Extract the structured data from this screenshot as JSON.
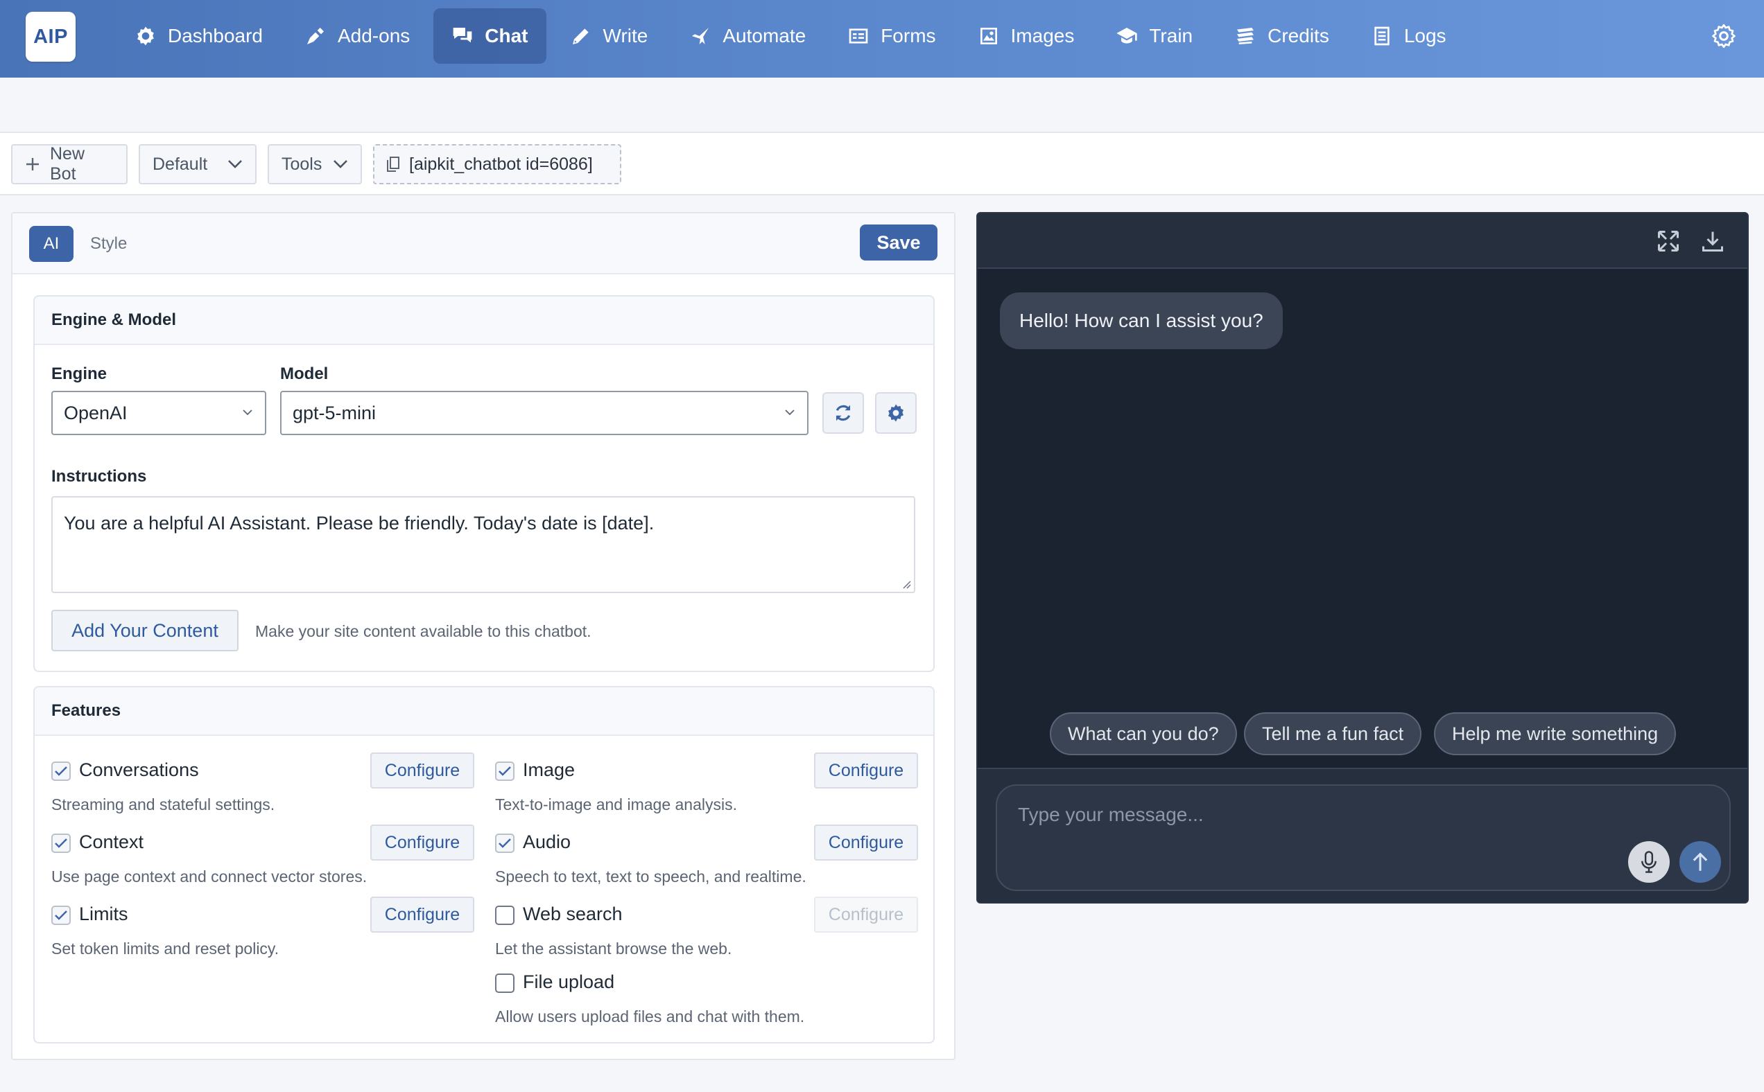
{
  "app": {
    "logo_text": "AIP"
  },
  "nav": {
    "items": [
      {
        "label": "Dashboard",
        "icon": "dashboard-icon"
      },
      {
        "label": "Add-ons",
        "icon": "addons-icon"
      },
      {
        "label": "Chat",
        "icon": "chat-icon",
        "active": true
      },
      {
        "label": "Write",
        "icon": "pencil-icon"
      },
      {
        "label": "Automate",
        "icon": "automate-icon"
      },
      {
        "label": "Forms",
        "icon": "forms-icon"
      },
      {
        "label": "Images",
        "icon": "images-icon"
      },
      {
        "label": "Train",
        "icon": "train-icon"
      },
      {
        "label": "Credits",
        "icon": "credits-icon"
      },
      {
        "label": "Logs",
        "icon": "logs-icon"
      }
    ],
    "settings_icon": "gear-icon"
  },
  "toolbar": {
    "new_bot": "New Bot",
    "bot_select": "Default",
    "tools": "Tools",
    "shortcode": "[aipkit_chatbot id=6086]"
  },
  "editor": {
    "tabs": {
      "ai": "AI",
      "style": "Style"
    },
    "save": "Save",
    "engine_card": {
      "title": "Engine & Model",
      "engine_label": "Engine",
      "engine_value": "OpenAI",
      "model_label": "Model",
      "model_value": "gpt-5-mini",
      "instructions_label": "Instructions",
      "instructions_value": "You are a helpful AI Assistant. Please be friendly. Today's date is [date].",
      "add_content": "Add Your Content",
      "add_content_hint": "Make your site content available to this chatbot."
    },
    "features_card": {
      "title": "Features",
      "configure_label": "Configure",
      "items": [
        {
          "name": "Conversations",
          "desc": "Streaming and stateful settings.",
          "checked": true,
          "configurable": true
        },
        {
          "name": "Image",
          "desc": "Text-to-image and image analysis.",
          "checked": true,
          "configurable": true
        },
        {
          "name": "Context",
          "desc": "Use page context and connect vector stores.",
          "checked": true,
          "configurable": true
        },
        {
          "name": "Audio",
          "desc": "Speech to text, text to speech, and realtime.",
          "checked": true,
          "configurable": true
        },
        {
          "name": "Limits",
          "desc": "Set token limits and reset policy.",
          "checked": true,
          "configurable": true
        },
        {
          "name": "Web search",
          "desc": "Let the assistant browse the web.",
          "checked": false,
          "configurable": false
        },
        {
          "name": "File upload",
          "desc": "Allow users upload files and chat with them.",
          "checked": false,
          "configurable": null
        }
      ]
    }
  },
  "chat_preview": {
    "greeting": "Hello! How can I assist you?",
    "suggestions": [
      "What can you do?",
      "Tell me a fun fact",
      "Help me write something"
    ],
    "input_placeholder": "Type your message...",
    "colors": {
      "background": "#1b2230",
      "header": "#262f3e",
      "bubble": "#3b4556",
      "send": "#4a6fa5"
    }
  },
  "colors": {
    "accent": "#3e64a8",
    "nav_gradient_start": "#4a74b8",
    "nav_gradient_end": "#6a97dc"
  }
}
